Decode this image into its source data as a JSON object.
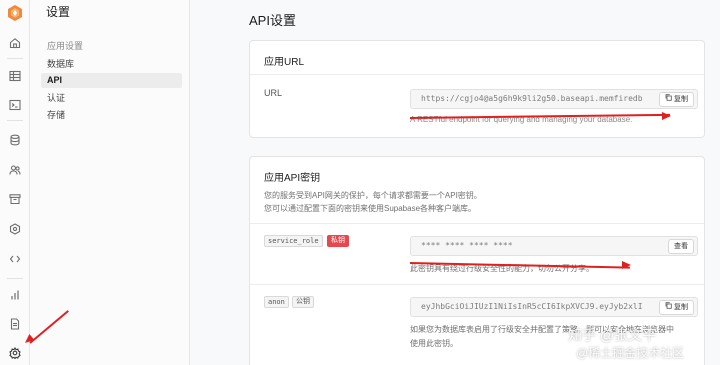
{
  "menu": {
    "title": "设置",
    "group_label": "应用设置",
    "items": [
      {
        "label": "数据库",
        "active": false
      },
      {
        "label": "API",
        "active": true
      },
      {
        "label": "认证",
        "active": false
      },
      {
        "label": "存储",
        "active": false
      }
    ]
  },
  "page": {
    "title": "API设置"
  },
  "url_card": {
    "title": "应用URL",
    "field_label": "URL",
    "url_value": "https://cgjo4@a5g6h9k9li2g50.baseapi.memfiredb",
    "copy_label": "复制",
    "description": "A RESTful endpoint for querying and managing your database."
  },
  "keys_card": {
    "title": "应用API密钥",
    "intro_line1": "您的服务受到API网关的保护，每个请求都需要一个API密钥。",
    "intro_line2": "您可以通过配置下面的密钥来使用Supabase各种客户端库。",
    "service_role": {
      "name": "service_role",
      "badge": "私钥",
      "masked_value": "**** **** **** ****",
      "reveal_label": "查看",
      "hint": "此密钥具有绕过行级安全性的能力，切勿公开分享。"
    },
    "anon": {
      "name": "anon",
      "badge": "公钥",
      "value": "eyJhbGciOiJIUzI1NiIsInR5cCI6IkpXVCJ9.eyJyb2xlI",
      "copy_label": "复制",
      "hint_line1": "如果您为数据库表启用了行级安全并配置了策略，则可以安全地在浏览器中",
      "hint_line2": "使用此密钥。"
    }
  },
  "watermark": {
    "line1": "知乎 @张文平",
    "line2": "@稀土掘金技术社区"
  },
  "colors": {
    "accent_red": "#e02020",
    "badge_red": "#e5484d",
    "logo": "#f0883e"
  },
  "rail_icons": [
    "logo-icon",
    "home-icon",
    "table-icon",
    "terminal-icon",
    "database-icon",
    "users-icon",
    "archive-icon",
    "shield-icon",
    "code-icon",
    "chart-icon",
    "document-icon",
    "settings-icon"
  ]
}
